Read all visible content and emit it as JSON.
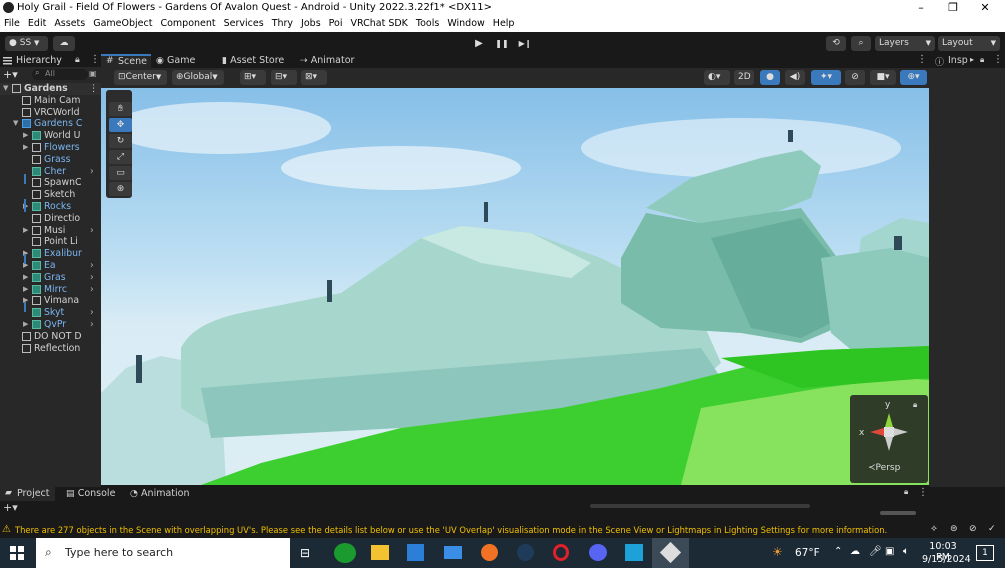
{
  "window": {
    "title": "Holy Grail - Field Of Flowers - Gardens Of Avalon Quest - Android - Unity 2022.3.22f1* <DX11>",
    "controls": [
      "–",
      "❐",
      "✕"
    ]
  },
  "menu": [
    "File",
    "Edit",
    "Assets",
    "GameObject",
    "Component",
    "Services",
    "Thry",
    "Jobs",
    "Poi",
    "VRChat SDK",
    "Tools",
    "Window",
    "Help"
  ],
  "toolbar": {
    "account": "SS",
    "cloud": "☁",
    "play": "▶",
    "pause": "❚❚",
    "step": "▶❙",
    "history_icon": "⟲",
    "search_icon": "⌕",
    "layers": "Layers",
    "layout": "Layout"
  },
  "hierarchy": {
    "tab": "Hierarchy",
    "search_placeholder": "All",
    "rows": [
      {
        "label": "Gardens",
        "indent": 0,
        "kind": "scene",
        "bold": true,
        "blue": false,
        "arrow": "down"
      },
      {
        "label": "Main Cam",
        "indent": 1,
        "kind": "white"
      },
      {
        "label": "VRCWorld",
        "indent": 1,
        "kind": "white"
      },
      {
        "label": "Gardens C",
        "indent": 1,
        "kind": "blue",
        "arrow": "down",
        "blue": true
      },
      {
        "label": "World U",
        "indent": 2,
        "kind": "green",
        "arrow": "right"
      },
      {
        "label": "Flowers",
        "indent": 2,
        "kind": "white",
        "arrow": "right",
        "blue": true
      },
      {
        "label": "Grass",
        "indent": 2,
        "kind": "white",
        "blue": true
      },
      {
        "label": "Cher",
        "indent": 2,
        "kind": "green",
        "blue": true,
        "more": true
      },
      {
        "label": "SpawnC",
        "indent": 2,
        "kind": "white"
      },
      {
        "label": "Sketch",
        "indent": 2,
        "kind": "white"
      },
      {
        "label": "Rocks",
        "indent": 2,
        "kind": "green",
        "arrow": "right",
        "blue": true
      },
      {
        "label": "Directio",
        "indent": 2,
        "kind": "white"
      },
      {
        "label": "Musi",
        "indent": 2,
        "kind": "white",
        "arrow": "right",
        "more": true
      },
      {
        "label": "Point Li",
        "indent": 2,
        "kind": "white"
      },
      {
        "label": "Exalibur",
        "indent": 2,
        "kind": "green",
        "arrow": "right",
        "blue": true
      },
      {
        "label": "Ea",
        "indent": 2,
        "kind": "green",
        "arrow": "right",
        "blue": true,
        "more": true
      },
      {
        "label": "Gras",
        "indent": 2,
        "kind": "green",
        "arrow": "right",
        "blue": true,
        "more": true
      },
      {
        "label": "Mirrc",
        "indent": 2,
        "kind": "green",
        "arrow": "right",
        "blue": true,
        "more": true
      },
      {
        "label": "Vimana",
        "indent": 2,
        "kind": "white",
        "arrow": "right"
      },
      {
        "label": "Skyt",
        "indent": 2,
        "kind": "green",
        "blue": true,
        "more": true
      },
      {
        "label": "QvPr",
        "indent": 2,
        "kind": "green",
        "arrow": "right",
        "blue": true,
        "more": true
      },
      {
        "label": "DO NOT D",
        "indent": 1,
        "kind": "white"
      },
      {
        "label": "Reflection",
        "indent": 1,
        "kind": "white"
      }
    ]
  },
  "scene_tabs": [
    "Scene",
    "Game",
    "Asset Store",
    "Animator"
  ],
  "scene_bar": {
    "pivot": "Center",
    "space": "Global",
    "mode_2d": "2D"
  },
  "gizmo": {
    "y": "y",
    "x": "x",
    "persp": "Persp"
  },
  "inspector": {
    "tab": "Insp"
  },
  "bottom_tabs": [
    "Project",
    "Console",
    "Animation"
  ],
  "status_message": "There are 277 objects in the Scene with overlapping UV's. Please see the details list below or use the 'UV Overlap' visualisation mode in the Scene View or Lightmaps in Lighting Settings for more information.",
  "taskbar": {
    "search_placeholder": "Type here to search",
    "weather": "67°F",
    "time": "10:03 PM",
    "date": "9/15/2024",
    "notification_count": "1"
  },
  "colors": {
    "accent": "#3a79bb",
    "warning": "#f0c000"
  }
}
